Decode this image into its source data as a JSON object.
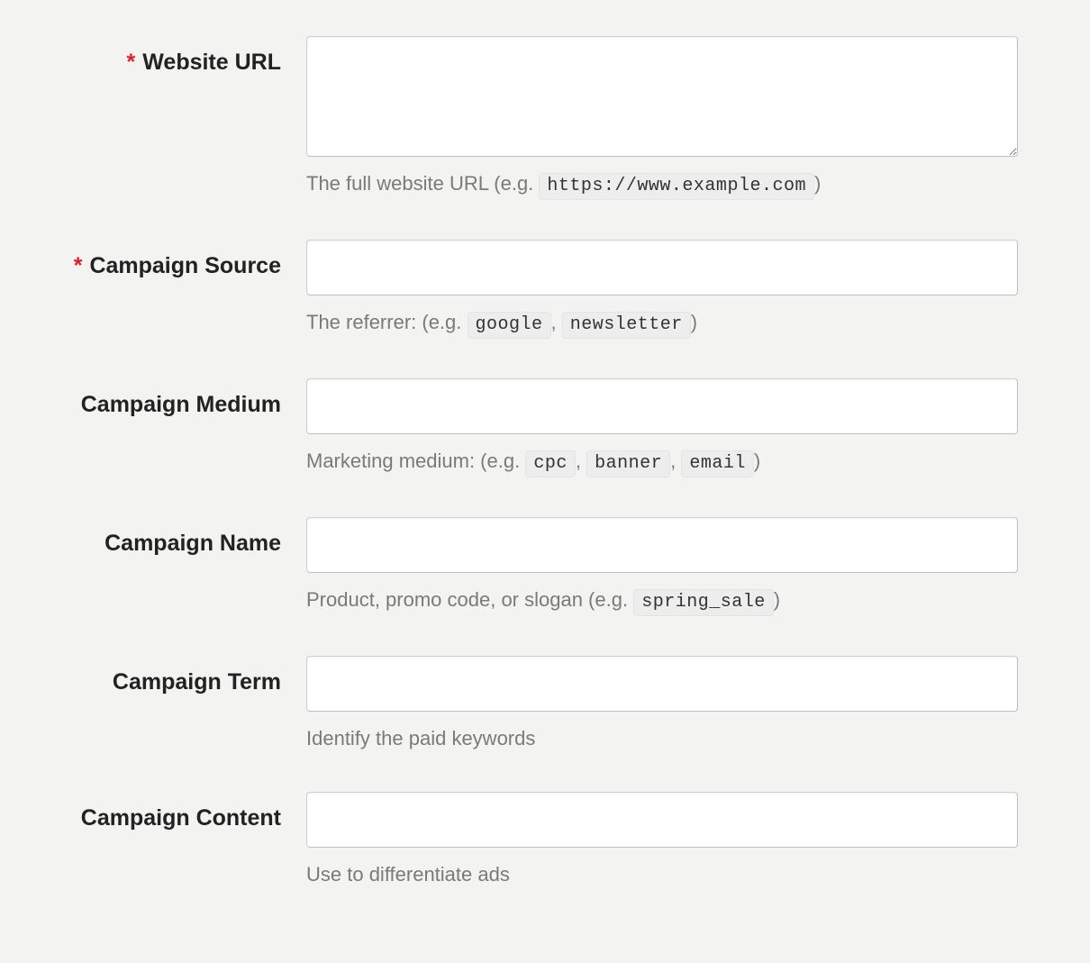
{
  "form": {
    "required_mark": "*",
    "website_url": {
      "label": "Website URL",
      "required": true,
      "value": "",
      "help_prefix": "The full website URL (e.g. ",
      "help_chips": [
        "https://www.example.com"
      ],
      "help_sep": "",
      "help_suffix": ")"
    },
    "campaign_source": {
      "label": "Campaign Source",
      "required": true,
      "value": "",
      "help_prefix": "The referrer: (e.g. ",
      "help_chips": [
        "google",
        "newsletter"
      ],
      "help_sep": ", ",
      "help_suffix": ")"
    },
    "campaign_medium": {
      "label": "Campaign Medium",
      "required": false,
      "value": "",
      "help_prefix": "Marketing medium: (e.g. ",
      "help_chips": [
        "cpc",
        "banner",
        "email"
      ],
      "help_sep": ", ",
      "help_suffix": ")"
    },
    "campaign_name": {
      "label": "Campaign Name",
      "required": false,
      "value": "",
      "help_prefix": "Product, promo code, or slogan (e.g. ",
      "help_chips": [
        "spring_sale"
      ],
      "help_sep": "",
      "help_suffix": ")"
    },
    "campaign_term": {
      "label": "Campaign Term",
      "required": false,
      "value": "",
      "help_prefix": "Identify the paid keywords",
      "help_chips": [],
      "help_sep": "",
      "help_suffix": ""
    },
    "campaign_content": {
      "label": "Campaign Content",
      "required": false,
      "value": "",
      "help_prefix": "Use to differentiate ads",
      "help_chips": [],
      "help_sep": "",
      "help_suffix": ""
    }
  }
}
